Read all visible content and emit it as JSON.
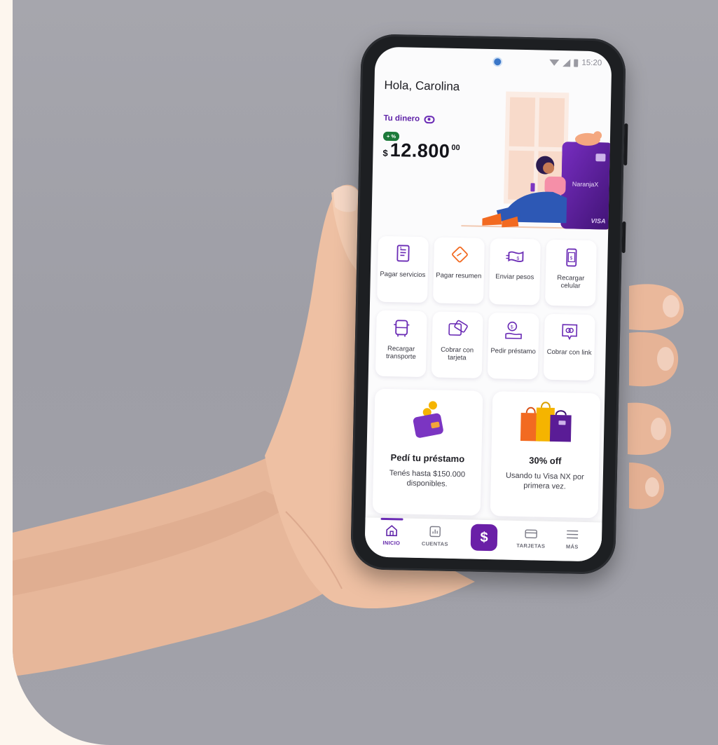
{
  "status_bar": {
    "time": "15:20"
  },
  "header": {
    "greeting_prefix": "Hola, ",
    "user_name": "Carolina"
  },
  "balance": {
    "label": "Tu dinero",
    "badge": "+ %",
    "currency": "$",
    "amount": "12.800",
    "cents": "00"
  },
  "card": {
    "brand": "NaranjaX",
    "network": "VISA"
  },
  "actions": [
    {
      "label": "Pagar servicios",
      "icon": "bill-icon"
    },
    {
      "label": "Pagar resumen",
      "icon": "card-tag-icon"
    },
    {
      "label": "Enviar pesos",
      "icon": "send-money-icon"
    },
    {
      "label": "Recargar celular",
      "icon": "phone-topup-icon"
    },
    {
      "label": "Recargar transporte",
      "icon": "bus-icon"
    },
    {
      "label": "Cobrar con tarjeta",
      "icon": "card-terminal-icon"
    },
    {
      "label": "Pedir préstamo",
      "icon": "loan-hand-icon"
    },
    {
      "label": "Cobrar con link",
      "icon": "link-icon"
    }
  ],
  "promos": [
    {
      "title": "Pedí tu préstamo",
      "description": "Tenés hasta $150.000 disponibles.",
      "icon": "wallet-coins-icon"
    },
    {
      "title": "30% off",
      "description": "Usando tu Visa NX por primera vez.",
      "icon": "shopping-bags-icon"
    }
  ],
  "nav": {
    "items": [
      {
        "label": "INICIO",
        "icon": "home-icon"
      },
      {
        "label": "CUENTAS",
        "icon": "chart-icon"
      },
      {
        "label": "",
        "icon": "dollar-icon"
      },
      {
        "label": "TARJETAS",
        "icon": "card-icon"
      },
      {
        "label": "MÁS",
        "icon": "menu-icon"
      }
    ],
    "center_symbol": "$"
  },
  "colors": {
    "brand_purple": "#6a1fa7",
    "accent_orange": "#f26a21",
    "badge_green": "#1d7a3a",
    "background_cream": "#fdf6ee"
  }
}
